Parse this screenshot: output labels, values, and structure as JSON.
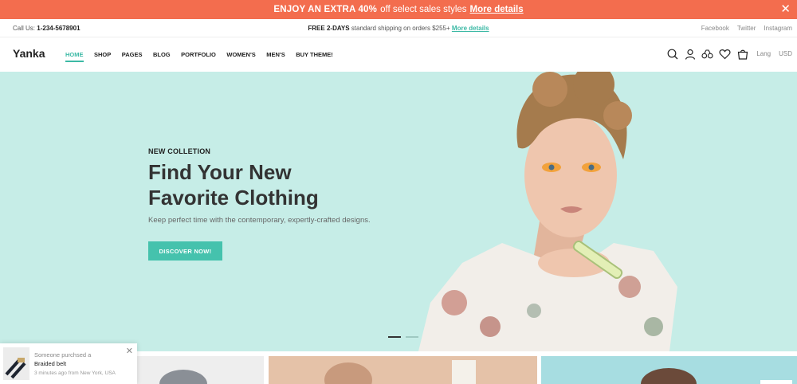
{
  "promo": {
    "bold": "ENJOY AN EXTRA 40%",
    "text": "off select sales styles",
    "link": "More details",
    "close": "✕"
  },
  "topbar": {
    "call_label": "Call Us:",
    "phone": "1-234-5678901",
    "ship_bold": "FREE 2-DAYS",
    "ship_text": "standard shipping on orders $255+",
    "ship_link": "More details",
    "social": [
      "Facebook",
      "Twitter",
      "Instagram"
    ]
  },
  "header": {
    "logo": "Yanka",
    "nav": [
      "HOME",
      "SHOP",
      "PAGES",
      "BLOG",
      "PORTFOLIO",
      "WOMEN'S",
      "MEN'S",
      "BUY THEME!"
    ],
    "lang": "Lang",
    "currency": "USD",
    "icons": [
      "search-icon",
      "user-icon",
      "compare-icon",
      "heart-icon",
      "cart-icon"
    ]
  },
  "hero": {
    "eyebrow": "NEW COLLETION",
    "title_line1": "Find Your New",
    "title_line2": "Favorite Clothing",
    "subtitle": "Keep perfect time with the contemporary, expertly-crafted designs.",
    "button": "DISCOVER NOW!",
    "active_slide": 1,
    "slides": 2
  },
  "notification": {
    "line1": "Someone purchsed a",
    "product": "Braided belt",
    "time": "3 minutes ago from New York, USA",
    "close": "✕"
  },
  "colors": {
    "promo_bg": "#f36d4e",
    "accent": "#3cb9a5",
    "hero_bg": "#c6ede7"
  }
}
